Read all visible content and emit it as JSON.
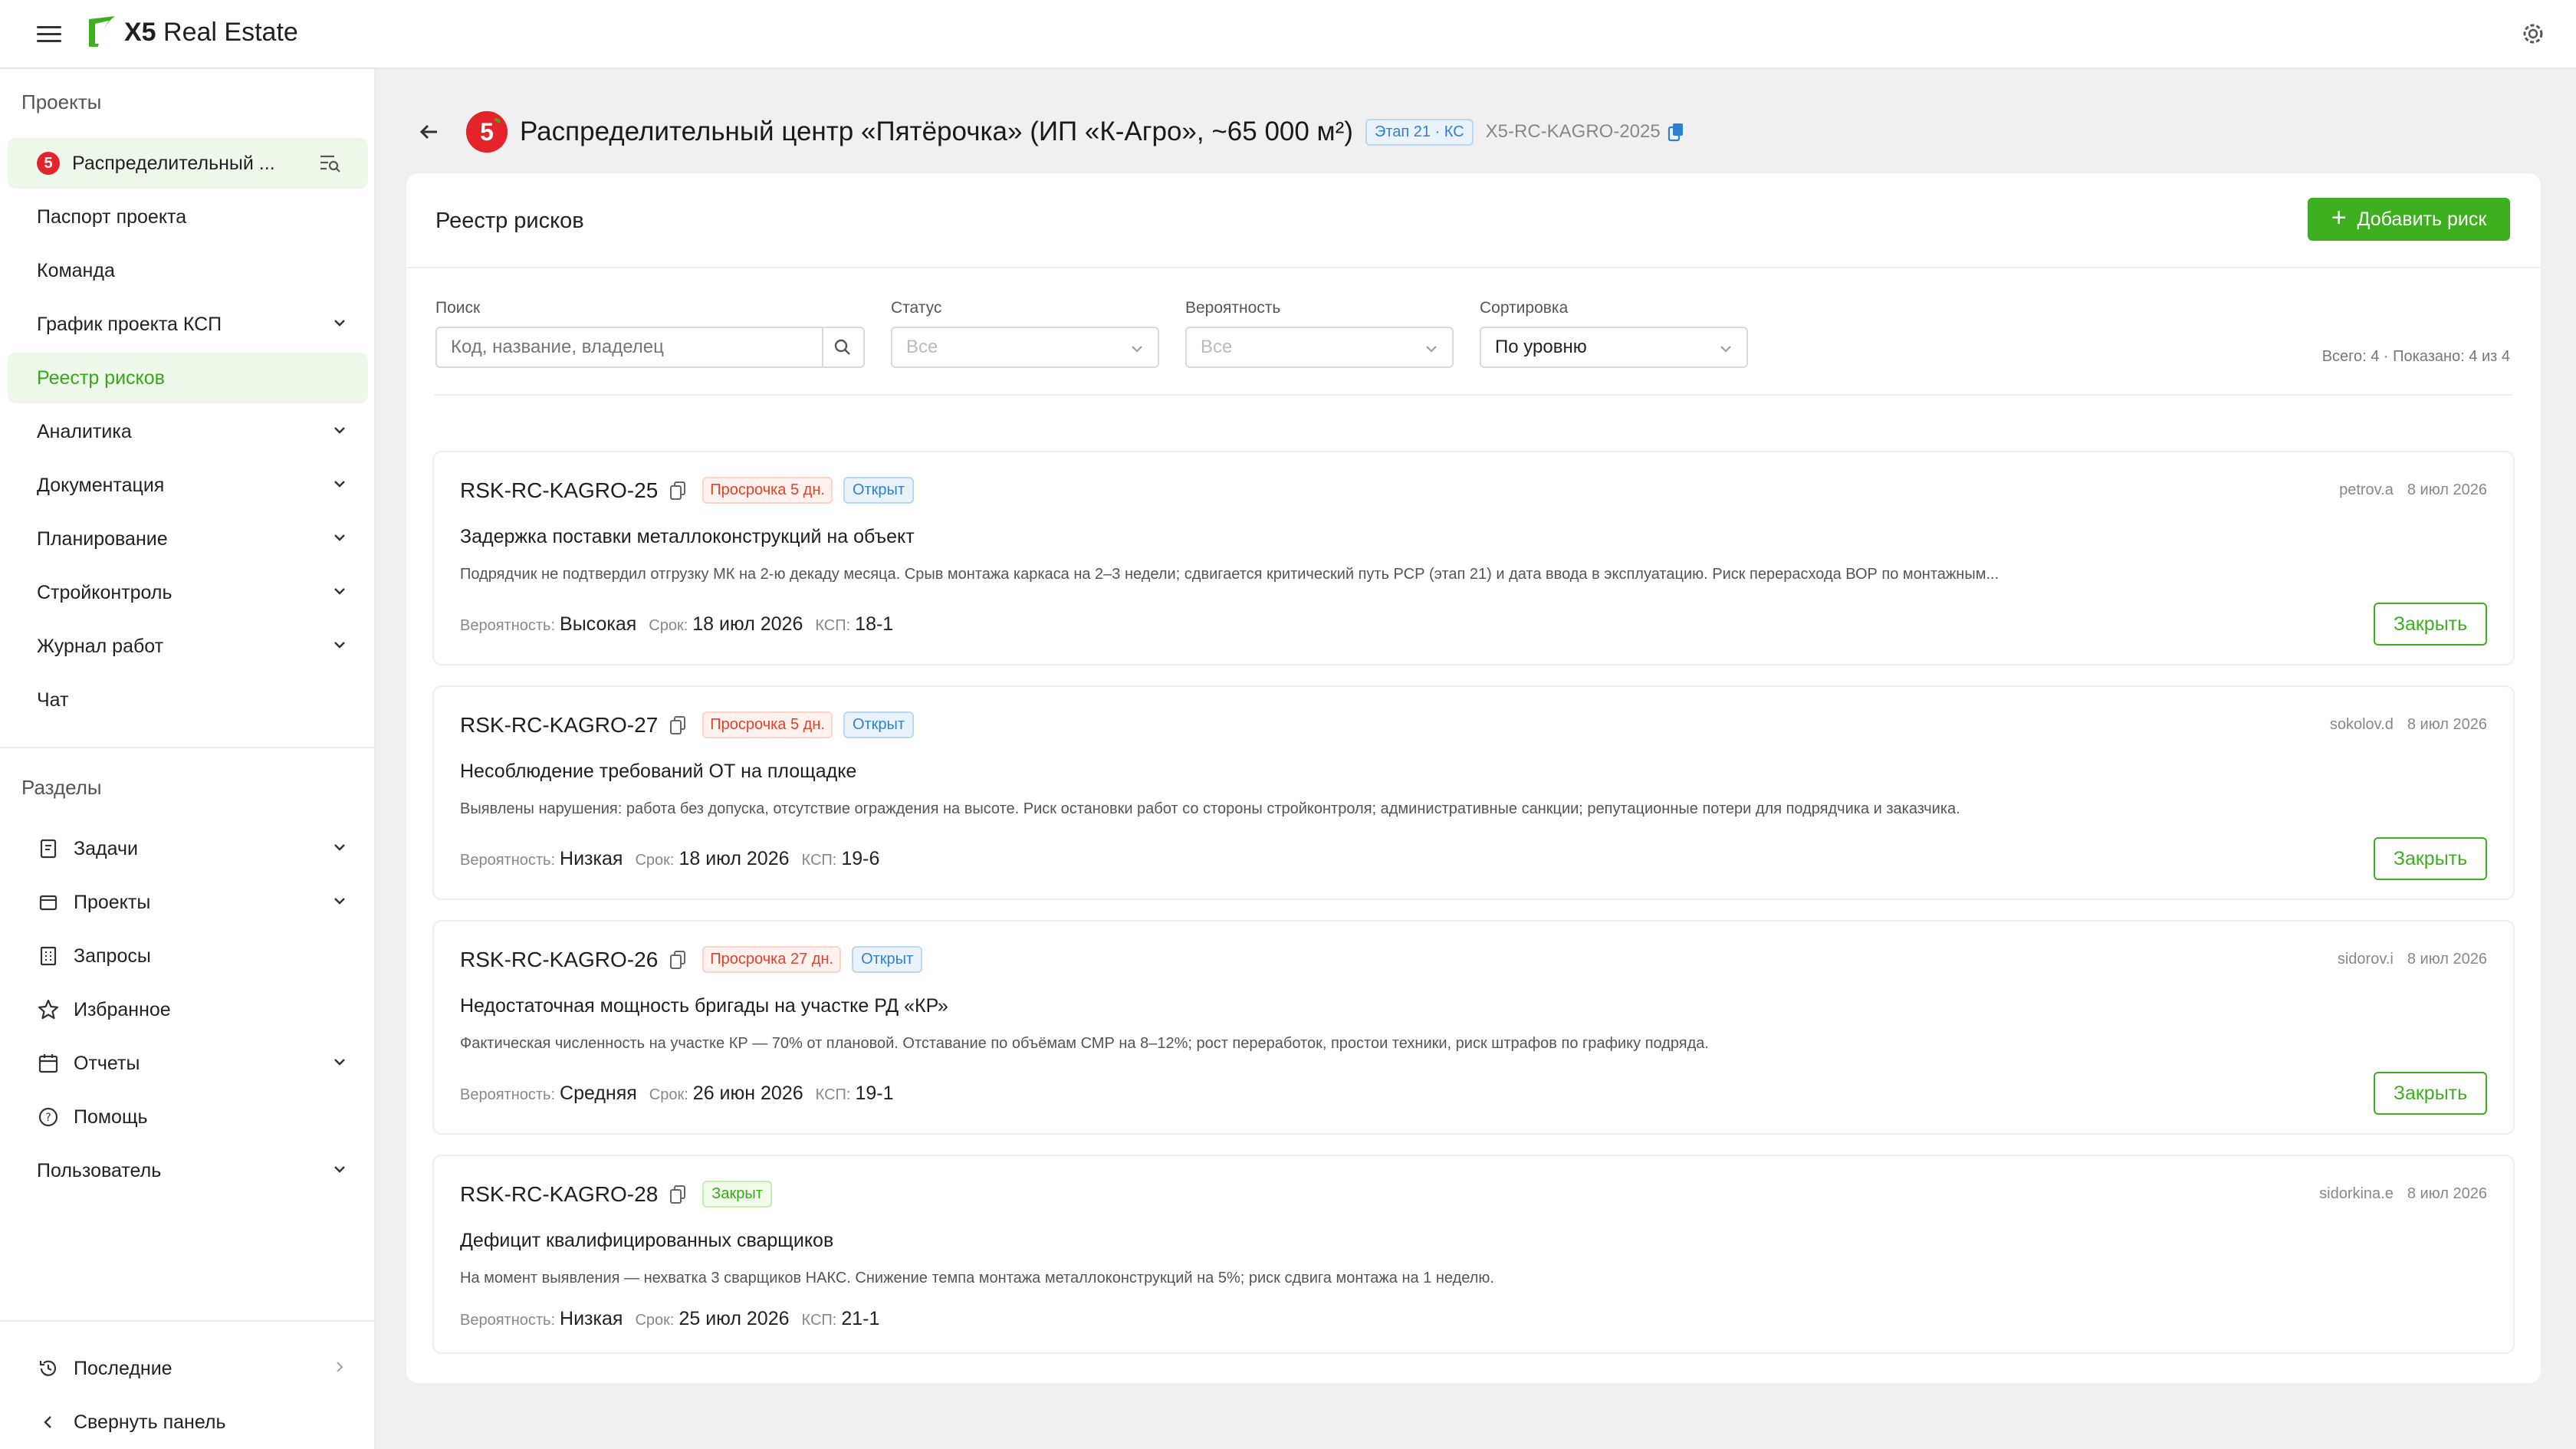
{
  "brand": {
    "logo_text_bold": "X5",
    "logo_text": " Real Estate",
    "accent": "#3eb01f"
  },
  "sidebar": {
    "projects_title": "Проекты",
    "current_project": "Распределительный ...",
    "project_items": [
      {
        "label": "Паспорт проекта",
        "has_chevron": false
      },
      {
        "label": "Команда",
        "has_chevron": false
      },
      {
        "label": "График проекта КСП",
        "has_chevron": true
      },
      {
        "label": "Реестр рисков",
        "has_chevron": false,
        "active": true
      },
      {
        "label": "Аналитика",
        "has_chevron": true
      },
      {
        "label": "Документация",
        "has_chevron": true
      },
      {
        "label": "Планирование",
        "has_chevron": true
      },
      {
        "label": "Стройконтроль",
        "has_chevron": true
      },
      {
        "label": "Журнал работ",
        "has_chevron": true
      },
      {
        "label": "Чат",
        "has_chevron": false
      }
    ],
    "sections_title": "Разделы",
    "section_items": [
      {
        "label": "Задачи",
        "icon": "tasks-icon",
        "has_chevron": true
      },
      {
        "label": "Проекты",
        "icon": "projects-icon",
        "has_chevron": true
      },
      {
        "label": "Запросы",
        "icon": "requests-icon",
        "has_chevron": false
      },
      {
        "label": "Избранное",
        "icon": "star-icon",
        "has_chevron": false
      },
      {
        "label": "Отчеты",
        "icon": "calendar-icon",
        "has_chevron": true
      },
      {
        "label": "Помощь",
        "icon": "help-icon",
        "has_chevron": false
      },
      {
        "label": "Пользователь",
        "icon": "",
        "has_chevron": true
      }
    ],
    "recent": "Последние",
    "collapse": "Свернуть панель"
  },
  "header": {
    "title": "Распределительный центр «Пятёрочка» (ИП «К-Агро», ~65 000 м²)",
    "stage": "Этап 21 · КС",
    "code": "X5-RC-KAGRO-2025"
  },
  "registry": {
    "title": "Реестр рисков",
    "add_button": "Добавить риск",
    "filters": {
      "search_label": "Поиск",
      "search_placeholder": "Код, название, владелец",
      "status_label": "Статус",
      "status_value": "Все",
      "probability_label": "Вероятность",
      "probability_value": "Все",
      "sort_label": "Сортировка",
      "sort_value": "По уровню"
    },
    "totals": "Всего: 4 · Показано: 4 из 4",
    "labels": {
      "probability": "Вероятность:",
      "due": "Срок:",
      "ksp": "КСП:",
      "close": "Закрыть"
    },
    "risks": [
      {
        "code": "RSK-RC-KAGRO-25",
        "overdue": "Просрочка 5 дн.",
        "status": "Открыт",
        "status_kind": "open",
        "owner": "petrov.a",
        "date": "8 июл 2026",
        "name": "Задержка поставки металлоконструкций на объект",
        "description": "Подрядчик не подтвердил отгрузку МК на 2-ю декаду месяца. Срыв монтажа каркаса на 2–3 недели; сдвигается критический путь РСР (этап 21) и дата ввода в эксплуатацию. Риск перерасхода ВОР по монтажным...",
        "probability": "Высокая",
        "due": "18 июл 2026",
        "ksp": "18-1"
      },
      {
        "code": "RSK-RC-KAGRO-27",
        "overdue": "Просрочка 5 дн.",
        "status": "Открыт",
        "status_kind": "open",
        "owner": "sokolov.d",
        "date": "8 июл 2026",
        "name": "Несоблюдение требований ОТ на площадке",
        "description": "Выявлены нарушения: работа без допуска, отсутствие ограждения на высоте. Риск остановки работ со стороны стройконтроля; административные санкции; репутационные потери для подрядчика и заказчика.",
        "probability": "Низкая",
        "due": "18 июл 2026",
        "ksp": "19-6"
      },
      {
        "code": "RSK-RC-KAGRO-26",
        "overdue": "Просрочка 27 дн.",
        "status": "Открыт",
        "status_kind": "open",
        "owner": "sidorov.i",
        "date": "8 июл 2026",
        "name": "Недостаточная мощность бригады на участке РД «КР»",
        "description": "Фактическая численность на участке КР — 70% от плановой. Отставание по объёмам СМР на 8–12%; рост переработок, простои техники, риск штрафов по графику подряда.",
        "probability": "Средняя",
        "due": "26 июн 2026",
        "ksp": "19-1"
      },
      {
        "code": "RSK-RC-KAGRO-28",
        "overdue": "",
        "status": "Закрыт",
        "status_kind": "closed",
        "owner": "sidorkina.e",
        "date": "8 июл 2026",
        "name": "Дефицит квалифицированных сварщиков",
        "description": "На момент выявления — нехватка 3 сварщиков НАКС. Снижение темпа монтажа металлоконструкций на 5%; риск сдвига монтажа на 1 неделю.",
        "probability": "Низкая",
        "due": "25 июл 2026",
        "ksp": "21-1"
      }
    ]
  }
}
